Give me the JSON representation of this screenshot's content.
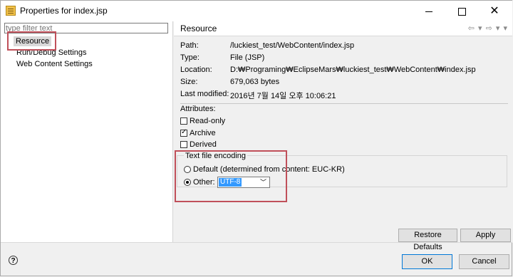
{
  "window": {
    "title": "Properties for index.jsp"
  },
  "title_controls": {
    "minimize": "—",
    "maximize": "□",
    "close": "✕"
  },
  "filter": {
    "placeholder": "type filter text"
  },
  "tree": {
    "items": [
      {
        "label": "Resource"
      },
      {
        "label": "Run/Debug Settings"
      },
      {
        "label": "Web Content Settings"
      }
    ]
  },
  "panel": {
    "title": "Resource",
    "nav": "⇦ ▾ ⇨ ▾ ▾",
    "info": [
      {
        "label": "Path:",
        "value": "/luckiest_test/WebContent/index.jsp"
      },
      {
        "label": "Type:",
        "value": "File  (JSP)"
      },
      {
        "label": "Location:",
        "value": "D:₩Programing₩EclipseMars₩luckiest_test₩WebContent₩index.jsp"
      },
      {
        "label": "Size:",
        "value": "679,063   bytes"
      },
      {
        "label": "Last modified:",
        "value": "2016년 7월 14일 오후 10:06:21"
      }
    ],
    "attributes_label": "Attributes:",
    "attributes": [
      {
        "label": "Read-only",
        "checked": false
      },
      {
        "label": "Archive",
        "checked": true
      },
      {
        "label": "Derived",
        "checked": false
      }
    ],
    "encoding": {
      "group_label": "Text file encoding",
      "default_label": "Default (determined from content: EUC-KR)",
      "other_label": "Other:",
      "other_value": "UTF-8"
    },
    "buttons": {
      "restore": "Restore Defaults",
      "apply": "Apply"
    }
  },
  "footer": {
    "help": "?",
    "ok": "OK",
    "cancel": "Cancel"
  },
  "colors": {
    "highlight": "#3399ff",
    "annotation": "#c0505a",
    "selection": "#d9d9d9"
  }
}
